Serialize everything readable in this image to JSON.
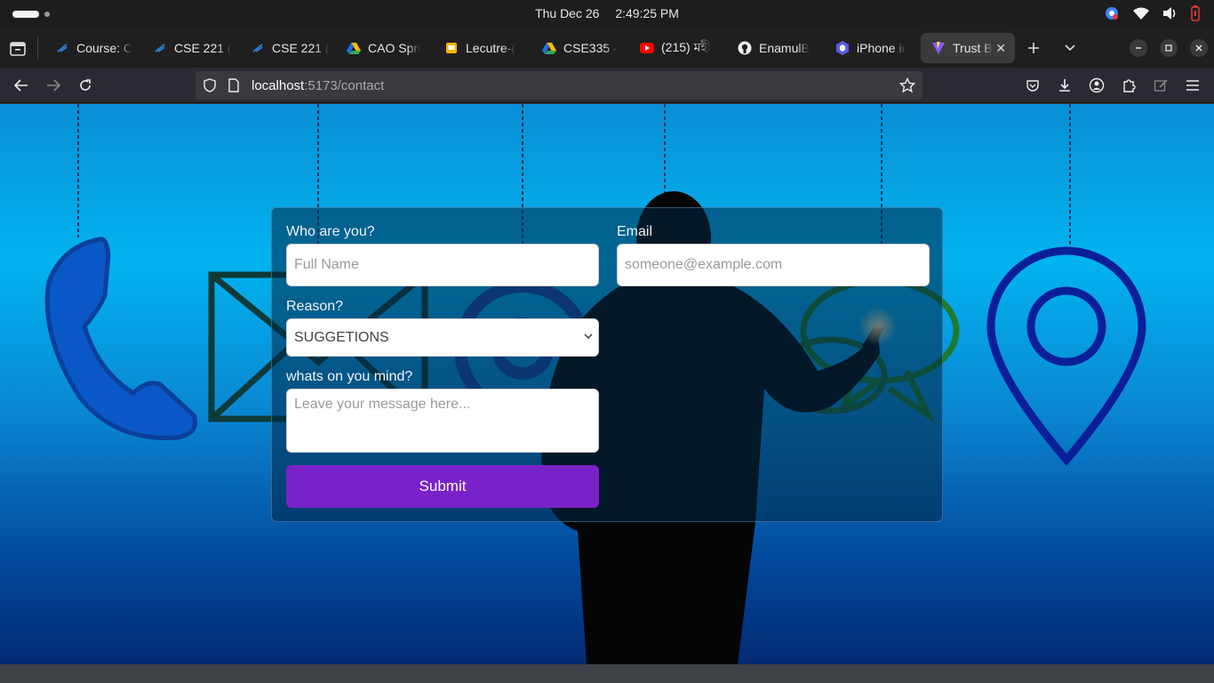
{
  "system_bar": {
    "date": "Thu Dec 26",
    "time": "2:49:25 PM"
  },
  "tabs": [
    {
      "label": "Course: C",
      "icon": "course-icon"
    },
    {
      "label": "CSE 221 (",
      "icon": "course-icon"
    },
    {
      "label": "CSE 221 (",
      "icon": "course-icon"
    },
    {
      "label": "CAO Spri",
      "icon": "google-drive-icon"
    },
    {
      "label": "Lecutre-(",
      "icon": "google-slides-icon"
    },
    {
      "label": "CSE335 -",
      "icon": "google-drive-icon"
    },
    {
      "label": "(215) মহী",
      "icon": "youtube-icon"
    },
    {
      "label": "EnamulB",
      "icon": "github-icon"
    },
    {
      "label": "iPhone ir",
      "icon": "hexagon-icon"
    },
    {
      "label": "Trust B",
      "icon": "vite-icon",
      "active": true
    }
  ],
  "address_bar": {
    "host": "localhost",
    "path": ":5173/contact"
  },
  "form": {
    "name_label": "Who are you?",
    "name_placeholder": "Full Name",
    "email_label": "Email",
    "email_placeholder": "someone@example.com",
    "reason_label": "Reason?",
    "reason_selected": "SUGGETIONS",
    "message_label": "whats on you mind?",
    "message_placeholder": "Leave your message here...",
    "submit_label": "Submit"
  },
  "colors": {
    "submit_button": "#7a22c9",
    "page_background_top": "#02b3f0",
    "page_background_bottom": "#022a72"
  }
}
